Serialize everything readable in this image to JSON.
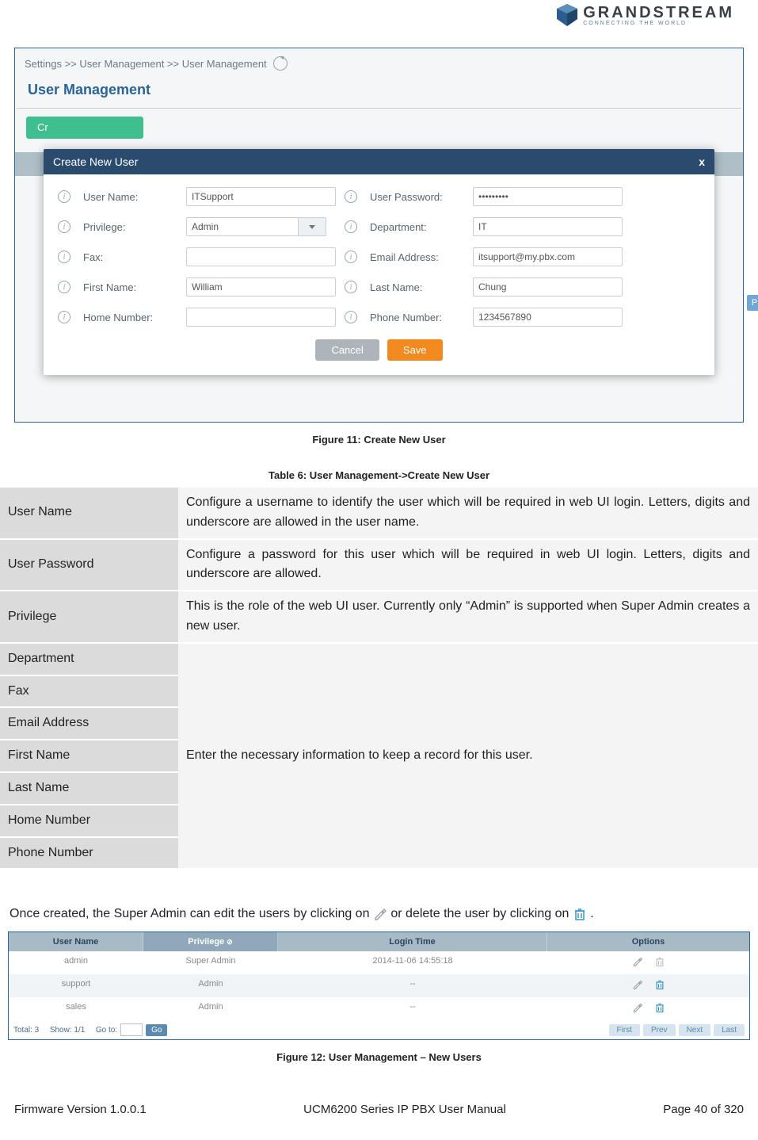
{
  "header": {
    "brand": "GRANDSTREAM",
    "tagline": "CONNECTING THE WORLD"
  },
  "screenshot1": {
    "breadcrumb": "Settings >> User Management >> User Management",
    "section_title": "User Management",
    "create_stub": "Cr",
    "modal": {
      "title": "Create New User",
      "close": "x",
      "fields": {
        "user_name_label": "User Name:",
        "user_name_value": "ITSupport",
        "user_password_label": "User Password:",
        "user_password_value": "•••••••••",
        "privilege_label": "Privilege:",
        "privilege_value": "Admin",
        "department_label": "Department:",
        "department_value": "IT",
        "fax_label": "Fax:",
        "fax_value": "",
        "email_label": "Email Address:",
        "email_value": "itsupport@my.pbx.com",
        "first_name_label": "First Name:",
        "first_name_value": "William",
        "last_name_label": "Last Name:",
        "last_name_value": "Chung",
        "home_number_label": "Home Number:",
        "home_number_value": "",
        "phone_number_label": "Phone Number:",
        "phone_number_value": "1234567890"
      },
      "cancel": "Cancel",
      "save": "Save"
    },
    "behind_btn": "Pre"
  },
  "figure11_caption": "Figure 11: Create New User",
  "table6_caption": "Table 6: User Management->Create New User",
  "table6": {
    "user_name": {
      "label": "User Name",
      "desc": "Configure a username to identify the user which will be required in web UI login. Letters, digits and underscore are allowed in the user name."
    },
    "user_password": {
      "label": "User Password",
      "desc": "Configure a password for this user which will be required in web UI login. Letters, digits and underscore are allowed."
    },
    "privilege": {
      "label": "Privilege",
      "desc": "This is the role of the web UI user. Currently only “Admin” is supported when Super Admin creates a new user."
    },
    "department": {
      "label": "Department"
    },
    "fax": {
      "label": "Fax"
    },
    "email": {
      "label": "Email Address"
    },
    "first_name": {
      "label": "First Name"
    },
    "last_name": {
      "label": "Last Name"
    },
    "home_number": {
      "label": "Home Number"
    },
    "phone_number": {
      "label": "Phone Number"
    },
    "group_desc": "Enter the necessary information to keep a record for this user."
  },
  "paragraph": {
    "before_edit": "Once created, the Super Admin can edit the users by clicking on ",
    "mid": " or delete the user by clicking on ",
    "end": "."
  },
  "fig12": {
    "headers": {
      "user_name": "User Name",
      "privilege": "Privilege",
      "sort_icon": "ⓢ",
      "login_time": "Login Time",
      "options": "Options"
    },
    "rows": [
      {
        "user": "admin",
        "priv": "Super Admin",
        "login": "2014-11-06 14:55:18",
        "trash_disabled": true
      },
      {
        "user": "support",
        "priv": "Admin",
        "login": "--",
        "trash_disabled": false
      },
      {
        "user": "sales",
        "priv": "Admin",
        "login": "--",
        "trash_disabled": false
      }
    ],
    "pager": {
      "total": "Total: 3",
      "show": "Show: 1/1",
      "goto": "Go to:",
      "go": "Go",
      "first": "First",
      "prev": "Prev",
      "next": "Next",
      "last": "Last"
    }
  },
  "figure12_caption": "Figure 12: User Management – New Users",
  "footer": {
    "left": "Firmware Version 1.0.0.1",
    "center": "UCM6200 Series IP PBX User Manual",
    "right": "Page 40 of 320"
  }
}
